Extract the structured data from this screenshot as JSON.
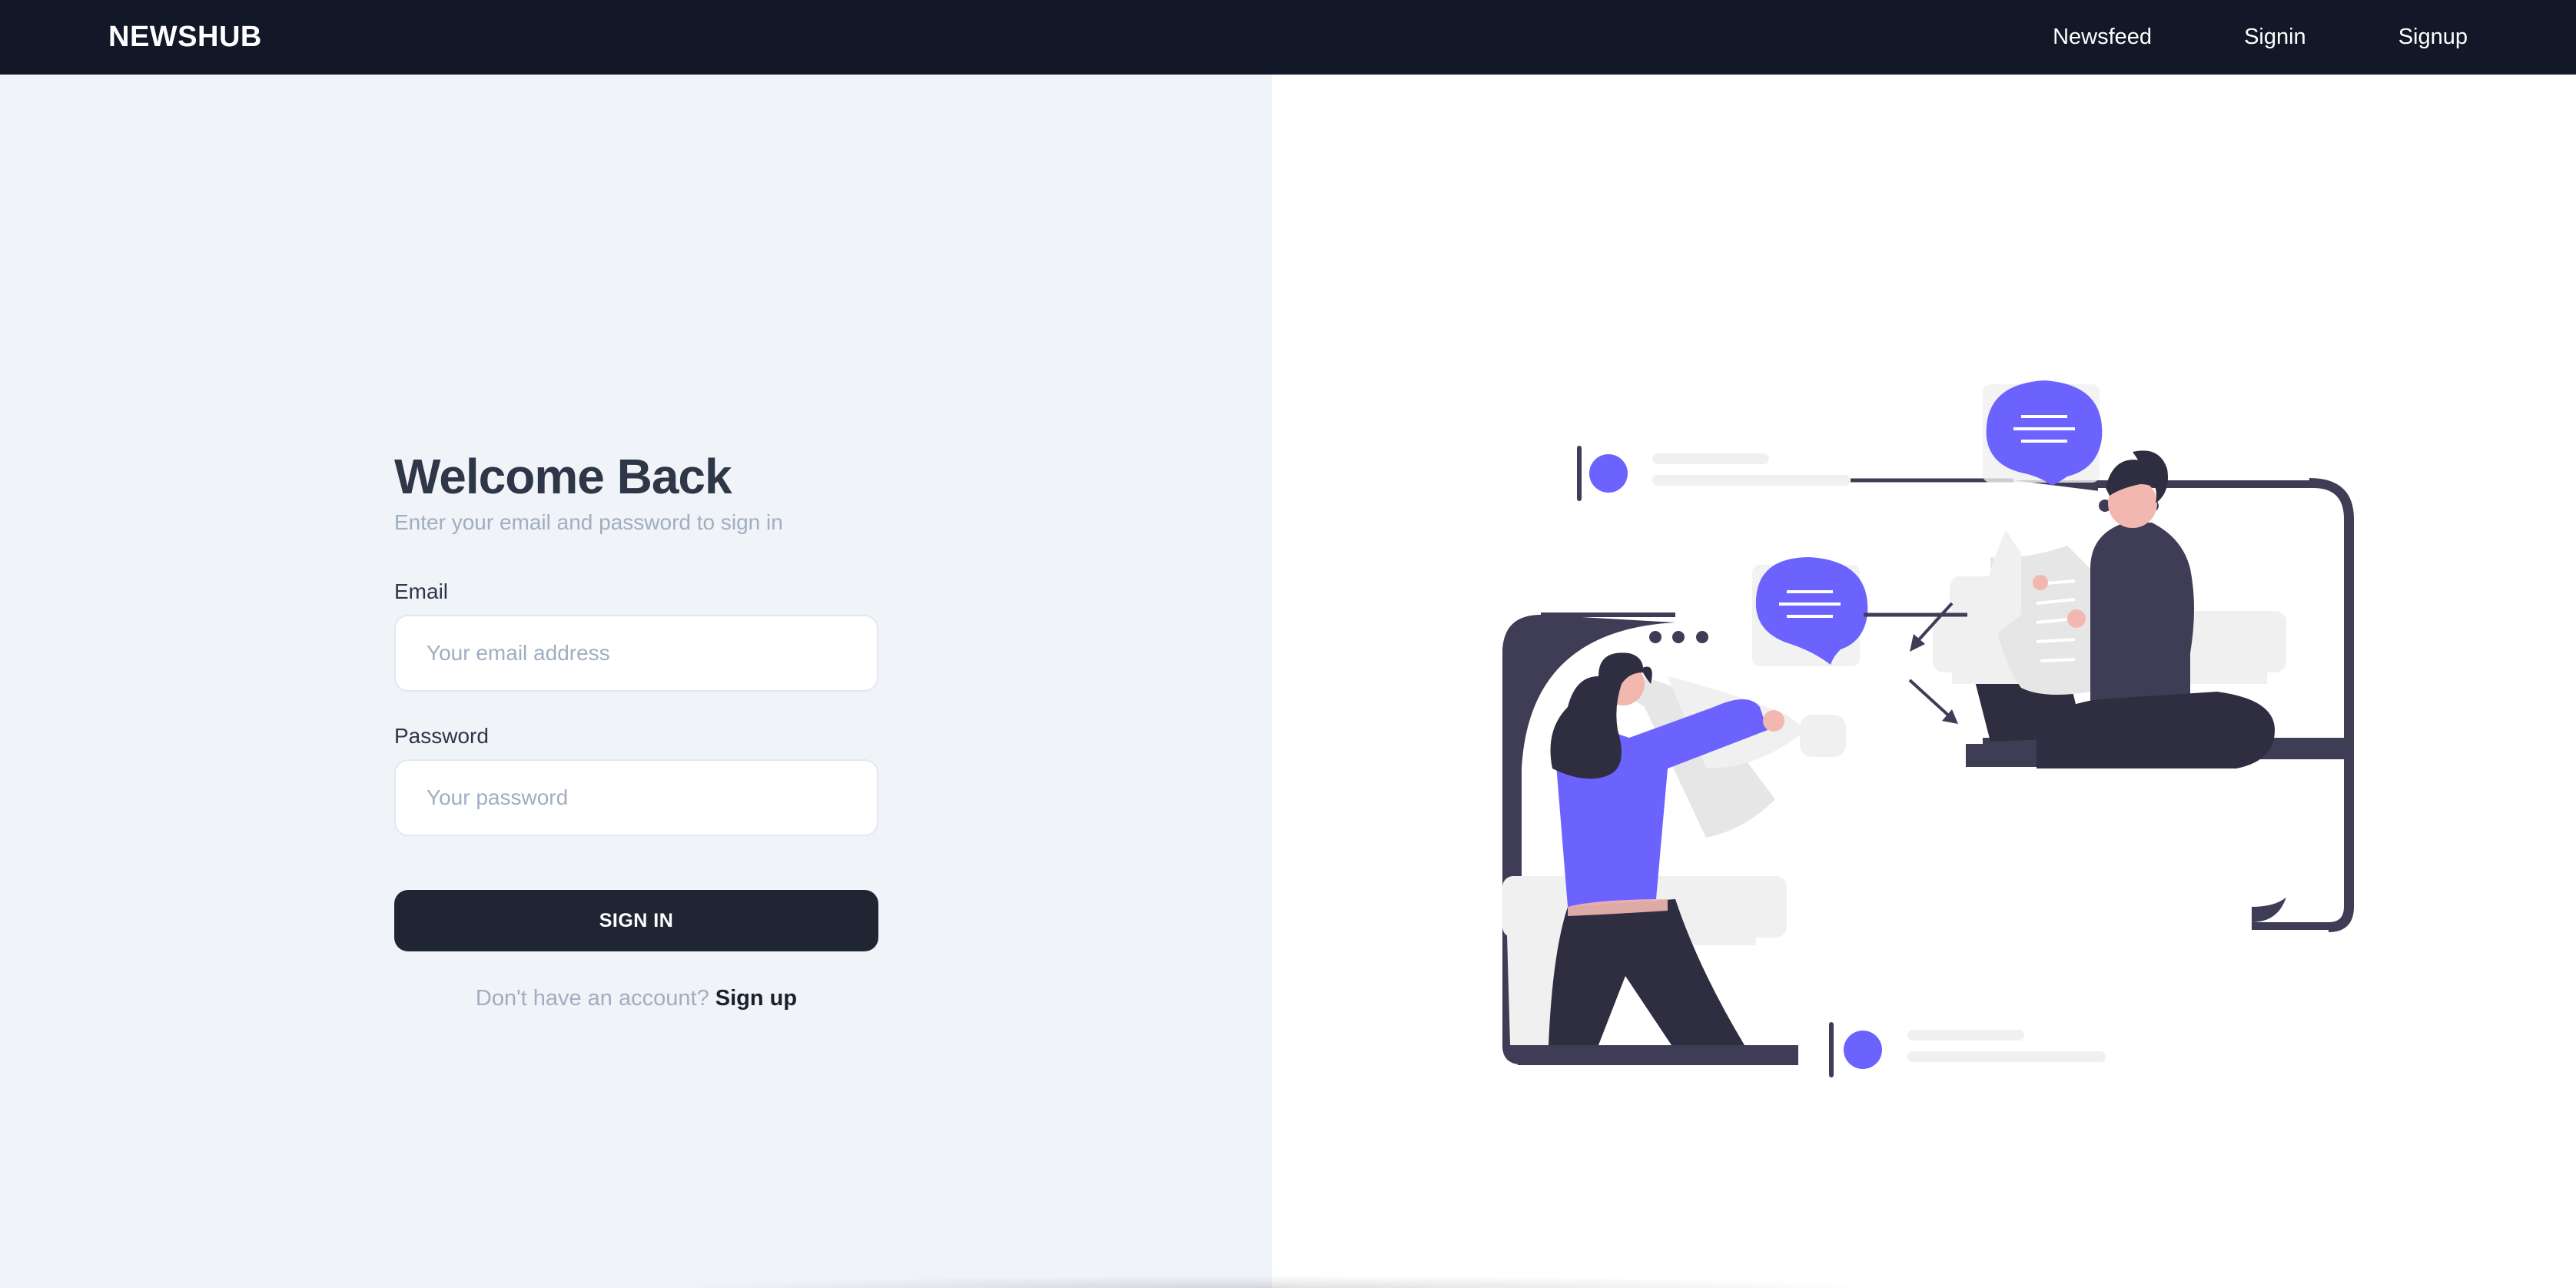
{
  "navbar": {
    "brand": "NEWSHUB",
    "links": [
      {
        "label": "Newsfeed"
      },
      {
        "label": "Signin"
      },
      {
        "label": "Signup"
      }
    ]
  },
  "form": {
    "title": "Welcome Back",
    "subtitle": "Enter your email and password to sign in",
    "email_label": "Email",
    "email_placeholder": "Your email address",
    "email_value": "",
    "password_label": "Password",
    "password_placeholder": "Your password",
    "password_value": "",
    "submit_label": "SIGN IN",
    "signup_prompt": "Don't have an account?",
    "signup_link": "Sign up"
  },
  "colors": {
    "navbar_bg": "#121828",
    "left_bg": "#f0f3f8",
    "button_bg": "#1f2533",
    "accent": "#6c63ff",
    "dark_figure": "#3f3d56"
  },
  "illustration": {
    "icon": "news-reading-illustration"
  }
}
